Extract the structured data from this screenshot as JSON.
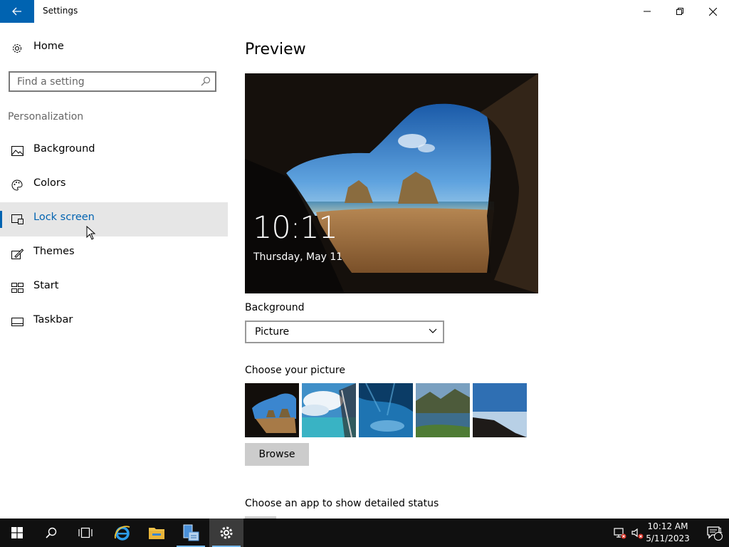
{
  "window": {
    "title": "Settings"
  },
  "sidebar": {
    "home_label": "Home",
    "search_placeholder": "Find a setting",
    "section_label": "Personalization",
    "items": [
      {
        "label": "Background",
        "icon": "picture-icon"
      },
      {
        "label": "Colors",
        "icon": "palette-icon"
      },
      {
        "label": "Lock screen",
        "icon": "lock-screen-icon",
        "selected": true
      },
      {
        "label": "Themes",
        "icon": "themes-icon"
      },
      {
        "label": "Start",
        "icon": "start-icon"
      },
      {
        "label": "Taskbar",
        "icon": "taskbar-icon"
      }
    ]
  },
  "main": {
    "preview_heading": "Preview",
    "preview_time": "10:11",
    "preview_date": "Thursday, May 11",
    "background_label": "Background",
    "background_value": "Picture",
    "choose_picture_label": "Choose your picture",
    "browse_label": "Browse",
    "detailed_status_label": "Choose an app to show detailed status"
  },
  "taskbar": {
    "clock_time": "10:12 AM",
    "clock_date": "5/11/2023",
    "notification_count": "1"
  },
  "colors": {
    "accent": "#0063b1",
    "taskbar": "#101010",
    "selected_nav_bg": "#e6e6e6"
  }
}
